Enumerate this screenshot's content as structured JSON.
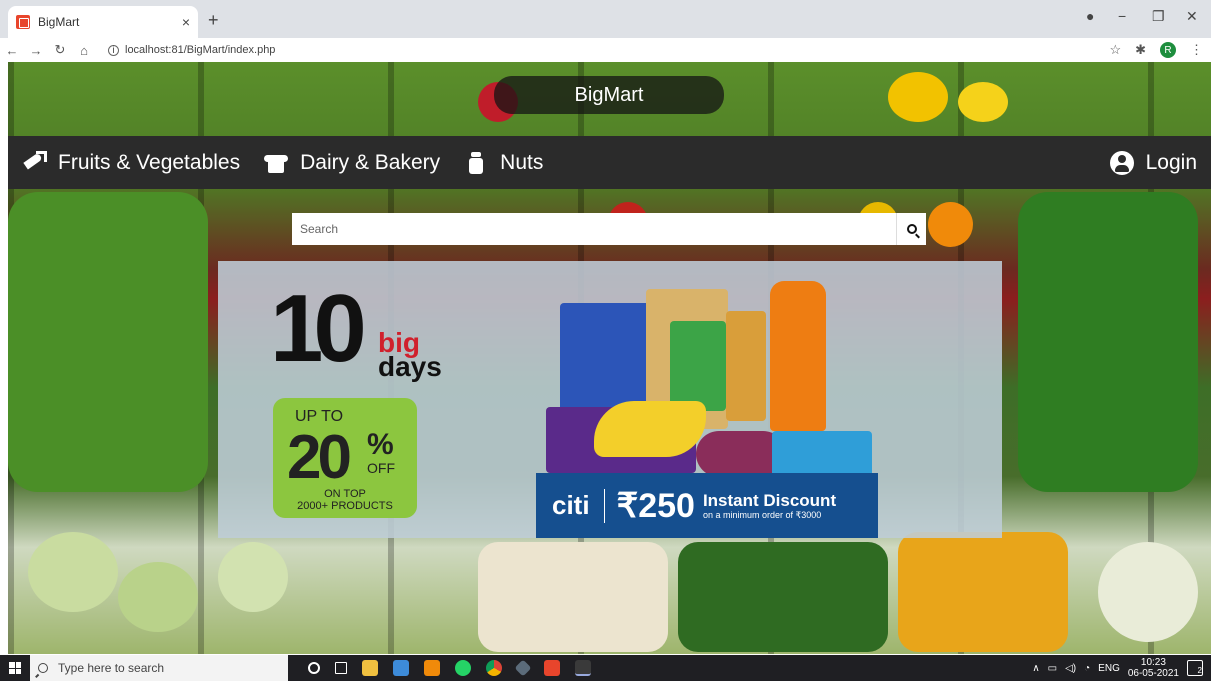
{
  "browser": {
    "tab_title": "BigMart",
    "tab_close": "×",
    "new_tab": "+",
    "url": "localhost:81/BigMart/index.php",
    "profile_initial": "R",
    "window_controls": [
      "−",
      "❐",
      "✕"
    ]
  },
  "site": {
    "title": "BigMart",
    "categories": [
      {
        "label": "Fruits & Vegetables",
        "icon": "carrot-icon"
      },
      {
        "label": "Dairy & Bakery",
        "icon": "shirt-icon"
      },
      {
        "label": "Nuts",
        "icon": "jar-icon"
      }
    ],
    "login_label": "Login",
    "search_placeholder": "Search"
  },
  "banner": {
    "ten": "10",
    "big": "big",
    "days": "days",
    "up_to": "UP TO",
    "percent": "20",
    "percent_sign": "%",
    "off": "OFF",
    "on_top_line1": "ON TOP",
    "on_top_line2": "2000+ PRODUCTS",
    "bank": "citi",
    "discount_amount": "₹250",
    "discount_title": "Instant Discount",
    "discount_sub": "on a minimum order of ₹3000"
  },
  "taskbar": {
    "search_placeholder": "Type here to search",
    "language": "ENG",
    "time": "10:23",
    "date": "06-05-2021",
    "notification_count": "2"
  },
  "colors": {
    "nav_bg": "#2b2b2b",
    "badge_green": "#8cc63f",
    "citi_blue": "#154f8f",
    "big_red": "#d0202c"
  }
}
